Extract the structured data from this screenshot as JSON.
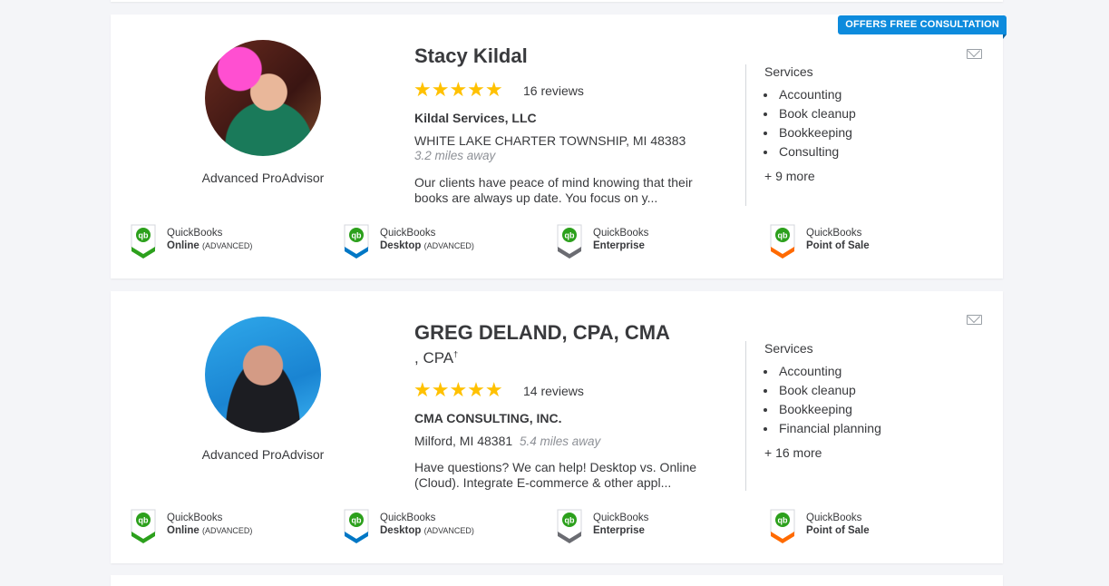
{
  "listings": [
    {
      "badge": "OFFERS FREE CONSULTATION",
      "name": "Stacy Kildal",
      "credentials": "",
      "rating_stars": 5,
      "stars": "★★★★★",
      "reviews": "16 reviews",
      "firm": "Kildal Services, LLC",
      "address": "WHITE LAKE CHARTER TOWNSHIP, MI 48383",
      "distance": "3.2 miles away",
      "description": "Our clients have peace of mind knowing that their books are always up date. You focus on y...",
      "level": "Advanced ProAdvisor",
      "services_title": "Services",
      "services": [
        "Accounting",
        "Book cleanup",
        "Bookkeeping",
        "Consulting"
      ],
      "more": "+ 9 more"
    },
    {
      "badge": "",
      "name": "GREG DELAND, CPA, CMA",
      "credentials": ", CPA",
      "credentials_mark": "†",
      "rating_stars": 5,
      "stars": "★★★★★",
      "reviews": "14 reviews",
      "firm": "CMA CONSULTING, INC.",
      "address": "Milford, MI 48381",
      "distance": "5.4 miles away",
      "description": "Have questions? We can help! Desktop vs. Online (Cloud). Integrate E-commerce & other appl...",
      "level": "Advanced ProAdvisor",
      "services_title": "Services",
      "services": [
        "Accounting",
        "Book cleanup",
        "Bookkeeping",
        "Financial planning"
      ],
      "more": "+ 16 more"
    }
  ],
  "certifications": [
    {
      "brand": "QuickBooks",
      "product": "Online",
      "level": "(ADVANCED)",
      "color": "#2ca01c"
    },
    {
      "brand": "QuickBooks",
      "product": "Desktop",
      "level": "(ADVANCED)",
      "color": "#0077c5"
    },
    {
      "brand": "QuickBooks",
      "product": "Enterprise",
      "level": "",
      "color": "#6b6c72"
    },
    {
      "brand": "QuickBooks",
      "product": "Point of Sale",
      "level": "",
      "color": "#ff6a00"
    }
  ],
  "icons": {
    "mail": "mail-icon",
    "shield": "quickbooks-certification-icon",
    "star": "star-icon"
  },
  "colors": {
    "accent": "#0d8bdd",
    "star": "#ffc100",
    "qb_green": "#2ca01c"
  }
}
